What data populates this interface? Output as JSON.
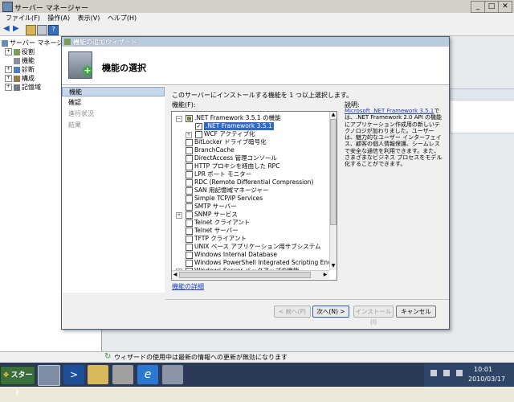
{
  "window": {
    "title": "サーバー マネージャー"
  },
  "menu": [
    "ファイル(F)",
    "操作(A)",
    "表示(V)",
    "ヘルプ(H)"
  ],
  "tree": {
    "root": "サーバー マネージャ",
    "items": [
      "役割",
      "機能",
      "診断",
      "構成",
      "記憶域"
    ]
  },
  "status": {
    "message": "ウィザードの使用中は最新の情報への更新が無効になります"
  },
  "wizard": {
    "title": "機能の追加ウィザード",
    "header": "機能の選択",
    "nav": [
      "機能",
      "確認",
      "進行状況",
      "結果"
    ],
    "instruction": "このサーバーにインストールする機能を 1 つ以上選択します。",
    "features_label": "機能(F):",
    "features": [
      {
        "label": ".NET Framework 3.5.1 の機能",
        "level": 0,
        "expander": "-",
        "check": "partial"
      },
      {
        "label": ".NET Framework 3.5.1",
        "level": 1,
        "expander": "",
        "check": "checked",
        "selected": true
      },
      {
        "label": "WCF アクティブ化",
        "level": 1,
        "expander": "+",
        "check": "none"
      },
      {
        "label": "BitLocker ドライブ暗号化",
        "level": 0,
        "expander": "",
        "check": "none"
      },
      {
        "label": "BranchCache",
        "level": 0,
        "expander": "",
        "check": "none"
      },
      {
        "label": "DirectAccess 管理コンソール",
        "level": 0,
        "expander": "",
        "check": "none"
      },
      {
        "label": "HTTP プロキシを経由した RPC",
        "level": 0,
        "expander": "",
        "check": "none"
      },
      {
        "label": "LPR ポート モニター",
        "level": 0,
        "expander": "",
        "check": "none"
      },
      {
        "label": "RDC (Remote Differential Compression)",
        "level": 0,
        "expander": "",
        "check": "none"
      },
      {
        "label": "SAN 用記憶域マネージャー",
        "level": 0,
        "expander": "",
        "check": "none"
      },
      {
        "label": "Simple TCP/IP Services",
        "level": 0,
        "expander": "",
        "check": "none"
      },
      {
        "label": "SMTP サーバー",
        "level": 0,
        "expander": "",
        "check": "none"
      },
      {
        "label": "SNMP サービス",
        "level": 0,
        "expander": "+",
        "check": "none"
      },
      {
        "label": "Telnet クライアント",
        "level": 0,
        "expander": "",
        "check": "none"
      },
      {
        "label": "Telnet サーバー",
        "level": 0,
        "expander": "",
        "check": "none"
      },
      {
        "label": "TFTP クライアント",
        "level": 0,
        "expander": "",
        "check": "none"
      },
      {
        "label": "UNIX ベース アプリケーション用サブシステム",
        "level": 0,
        "expander": "",
        "check": "none"
      },
      {
        "label": "Windows Internal Database",
        "level": 0,
        "expander": "",
        "check": "none"
      },
      {
        "label": "Windows PowerShell Integrated Scripting Environment",
        "level": 0,
        "expander": "",
        "check": "none"
      },
      {
        "label": "Windows Server バックアップの機能",
        "level": 0,
        "expander": "+",
        "check": "none"
      }
    ],
    "more_link": "機能の詳細",
    "description_title": "説明:",
    "description_link": "Microsoft .NET Framework 3.5.1",
    "description_text": "では、.NET Framework 2.0 API の機能にアプリケーション作成用の新しいテクノロジが加わりました。ユーザーは、魅力的なユーザー インターフェイス、顧客の個人情報保護、シームレスで安全な通信を利用できます。また、さまざまなビジネス プロセスをモデル化することができます。",
    "buttons": {
      "back": "< 前へ(P)",
      "next": "次へ(N) >",
      "install": "インストール(I)",
      "cancel": "キャンセル"
    }
  },
  "taskbar": {
    "start": "スタート",
    "time": "10:01",
    "date": "2010/03/17"
  }
}
